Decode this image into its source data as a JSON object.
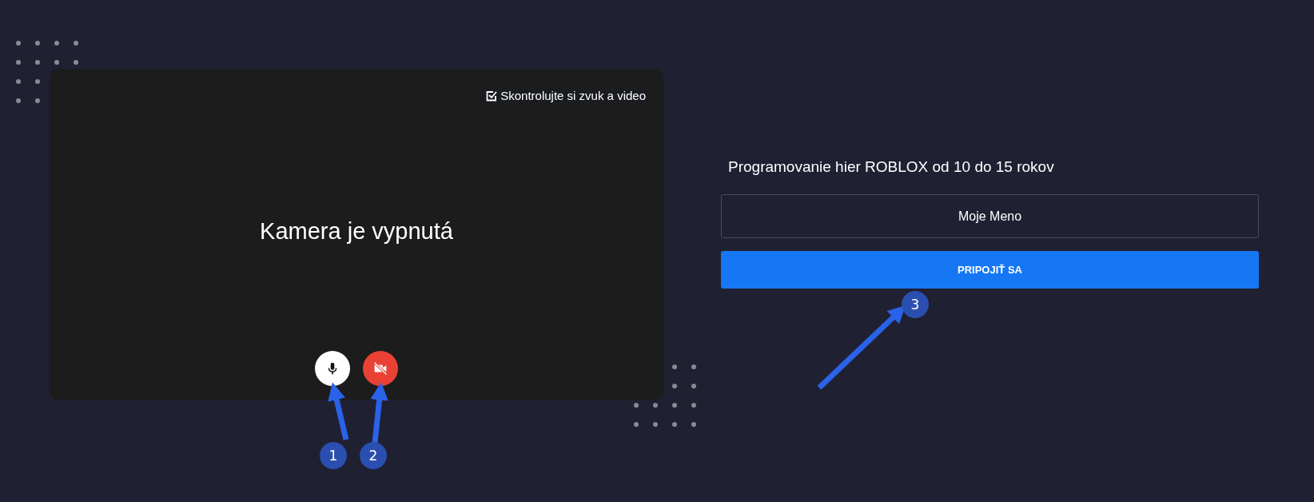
{
  "preview": {
    "check_label": "Skontrolujte si zvuk a video",
    "camera_message": "Kamera je vypnutá",
    "controls": [
      {
        "kind": "microphone",
        "on": true
      },
      {
        "kind": "camera",
        "on": false
      }
    ]
  },
  "join": {
    "title": "Programovanie hier ROBLOX od 10 do 15 rokov",
    "name_field": {
      "value": "Moje Meno"
    },
    "button": "PRIPOJIŤ SA"
  },
  "annotations": [
    {
      "label": "1"
    },
    {
      "label": "2"
    },
    {
      "label": "3"
    }
  ]
}
